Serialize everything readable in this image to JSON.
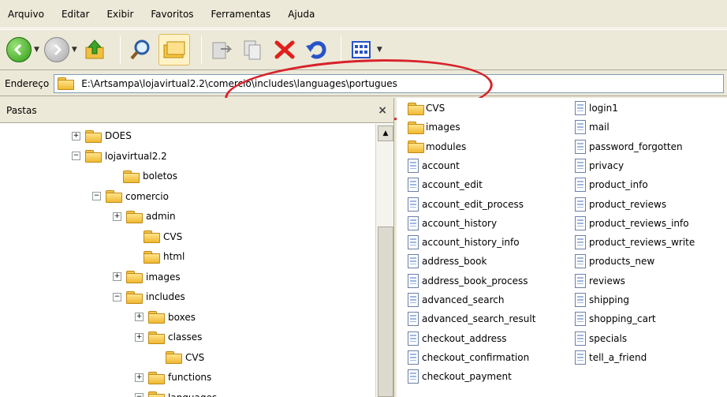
{
  "menu": [
    "Arquivo",
    "Editar",
    "Exibir",
    "Favoritos",
    "Ferramentas",
    "Ajuda"
  ],
  "toolbar": {
    "back": "back-arrow-icon",
    "forward": "forward-arrow-icon",
    "up": "up-folder-icon",
    "search": "search-icon",
    "folders": "folders-icon",
    "move": "move-to-icon",
    "copy": "copy-to-icon",
    "delete": "delete-icon",
    "undo": "undo-icon",
    "views": "views-icon"
  },
  "address": {
    "label": "Endereço",
    "value": "E:\\Artsampa\\lojavirtual2.2\\comercio\\includes\\languages\\portugues"
  },
  "folders_pane": {
    "title": "Pastas",
    "close": "×",
    "nodes": [
      {
        "label": "DOES",
        "expander": "+"
      },
      {
        "label": "lojavirtual2.2",
        "expander": "−"
      },
      {
        "label": "boletos",
        "expander": ""
      },
      {
        "label": "comercio",
        "expander": "−"
      },
      {
        "label": "admin",
        "expander": "+"
      },
      {
        "label": "CVS",
        "expander": ""
      },
      {
        "label": "html",
        "expander": ""
      },
      {
        "label": "images",
        "expander": "+"
      },
      {
        "label": "includes",
        "expander": "−"
      },
      {
        "label": "boxes",
        "expander": "+"
      },
      {
        "label": "classes",
        "expander": "+"
      },
      {
        "label": "CVS",
        "expander": ""
      },
      {
        "label": "functions",
        "expander": "+"
      },
      {
        "label": "languages",
        "expander": "−"
      }
    ]
  },
  "files_pane": {
    "col1": [
      {
        "label": "CVS",
        "type": "folder"
      },
      {
        "label": "images",
        "type": "folder"
      },
      {
        "label": "modules",
        "type": "folder"
      },
      {
        "label": "account",
        "type": "file"
      },
      {
        "label": "account_edit",
        "type": "file"
      },
      {
        "label": "account_edit_process",
        "type": "file"
      },
      {
        "label": "account_history",
        "type": "file"
      },
      {
        "label": "account_history_info",
        "type": "file"
      },
      {
        "label": "address_book",
        "type": "file"
      },
      {
        "label": "address_book_process",
        "type": "file"
      },
      {
        "label": "advanced_search",
        "type": "file"
      },
      {
        "label": "advanced_search_result",
        "type": "file"
      },
      {
        "label": "checkout_address",
        "type": "file"
      },
      {
        "label": "checkout_confirmation",
        "type": "file"
      },
      {
        "label": "checkout_payment",
        "type": "file"
      }
    ],
    "col2": [
      {
        "label": "login1",
        "type": "file"
      },
      {
        "label": "mail",
        "type": "file"
      },
      {
        "label": "password_forgotten",
        "type": "file"
      },
      {
        "label": "privacy",
        "type": "file"
      },
      {
        "label": "product_info",
        "type": "file"
      },
      {
        "label": "product_reviews",
        "type": "file"
      },
      {
        "label": "product_reviews_info",
        "type": "file"
      },
      {
        "label": "product_reviews_write",
        "type": "file"
      },
      {
        "label": "products_new",
        "type": "file"
      },
      {
        "label": "reviews",
        "type": "file"
      },
      {
        "label": "shipping",
        "type": "file"
      },
      {
        "label": "shopping_cart",
        "type": "file"
      },
      {
        "label": "specials",
        "type": "file"
      },
      {
        "label": "tell_a_friend",
        "type": "file"
      }
    ]
  },
  "colors": {
    "annotation": "#d8222a",
    "chrome": "#ece9d8",
    "folder": "#f0b932"
  }
}
